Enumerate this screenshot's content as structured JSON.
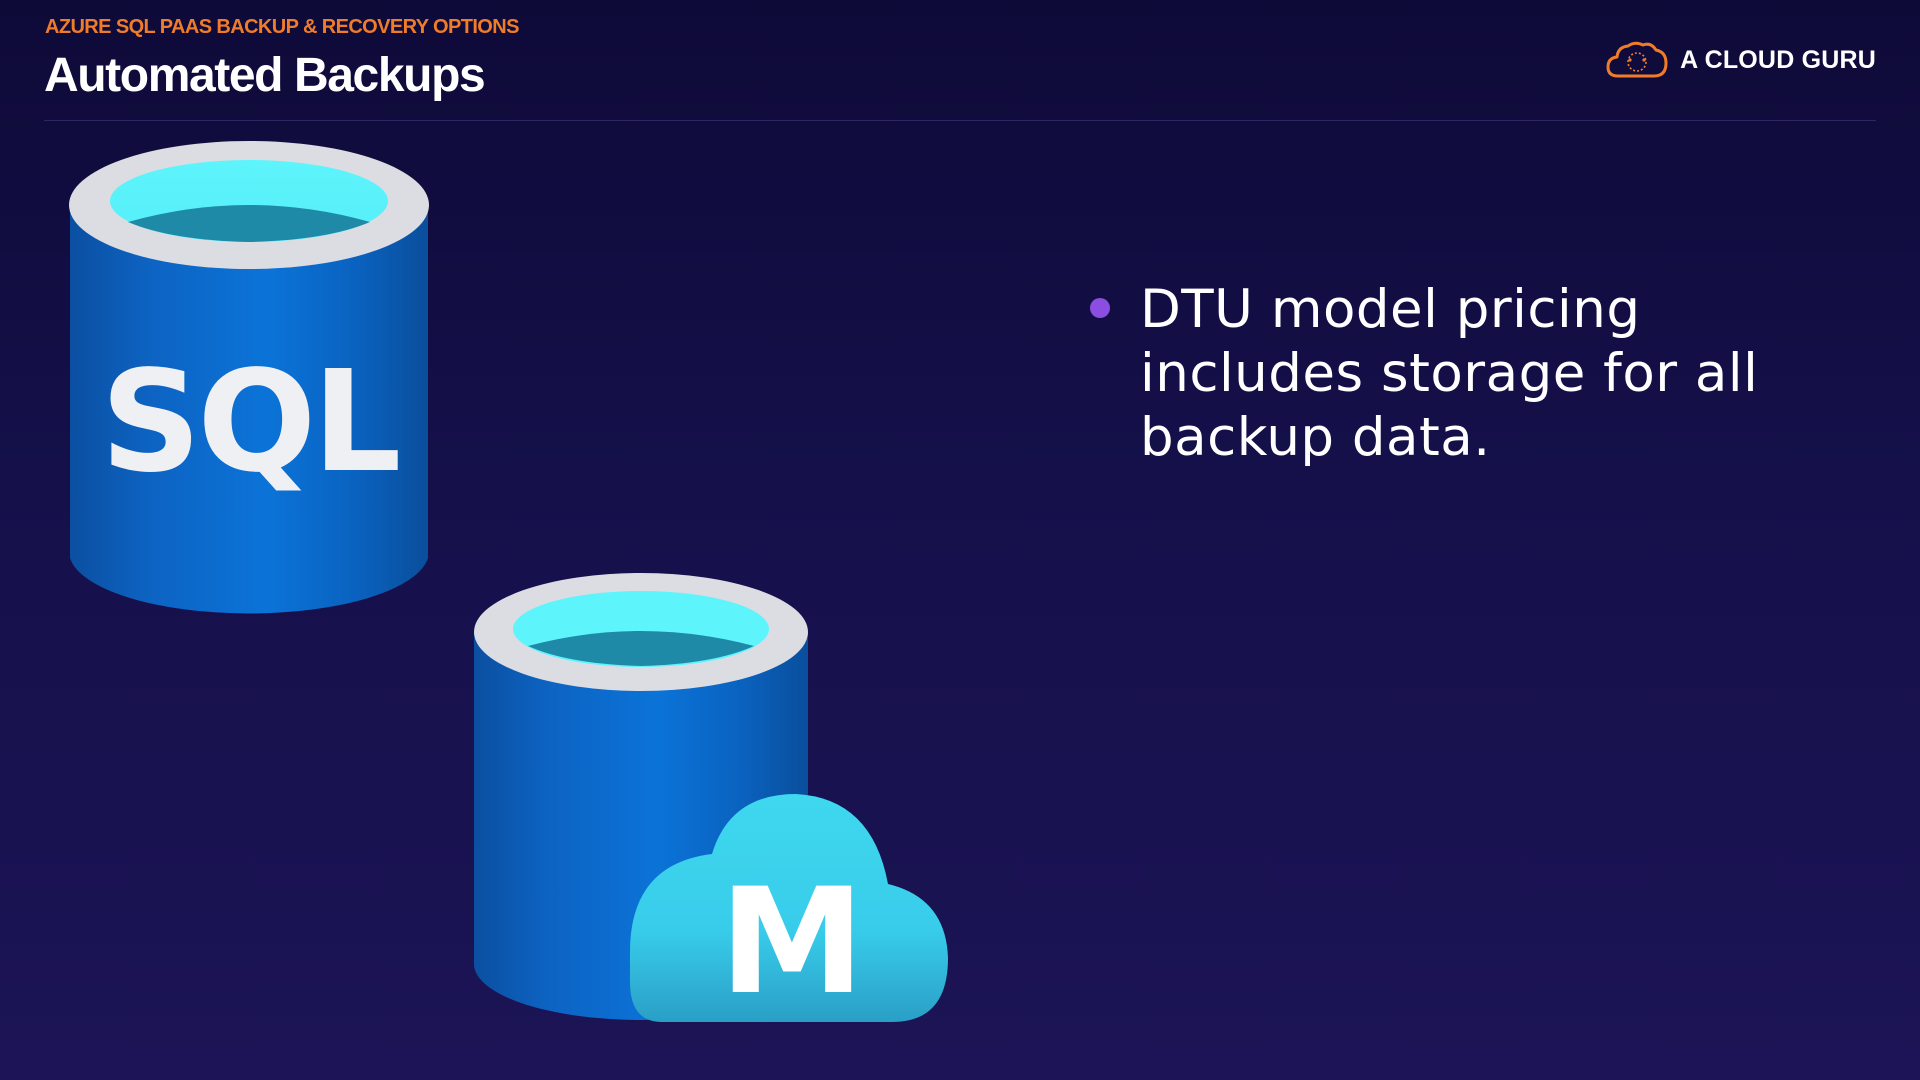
{
  "header": {
    "kicker": "AZURE SQL PAAS BACKUP & RECOVERY OPTIONS",
    "title": "Automated Backups"
  },
  "brand": {
    "name": "A CLOUD GURU",
    "icon": "cloud-logo-icon",
    "accent_color": "#f07c2a"
  },
  "graphics": {
    "sql_database": {
      "icon": "sql-database-icon",
      "label": "SQL"
    },
    "managed_instance": {
      "icon": "sql-managed-instance-icon",
      "badge": "M"
    }
  },
  "bullets": [
    {
      "text": "DTU model pricing includes storage for all backup data."
    }
  ],
  "colors": {
    "bullet": "#8b4ee0",
    "cylinder_blue": "#0a6dd0",
    "cylinder_top": "#5ef2fb",
    "cloud": "#3fd7ee"
  }
}
